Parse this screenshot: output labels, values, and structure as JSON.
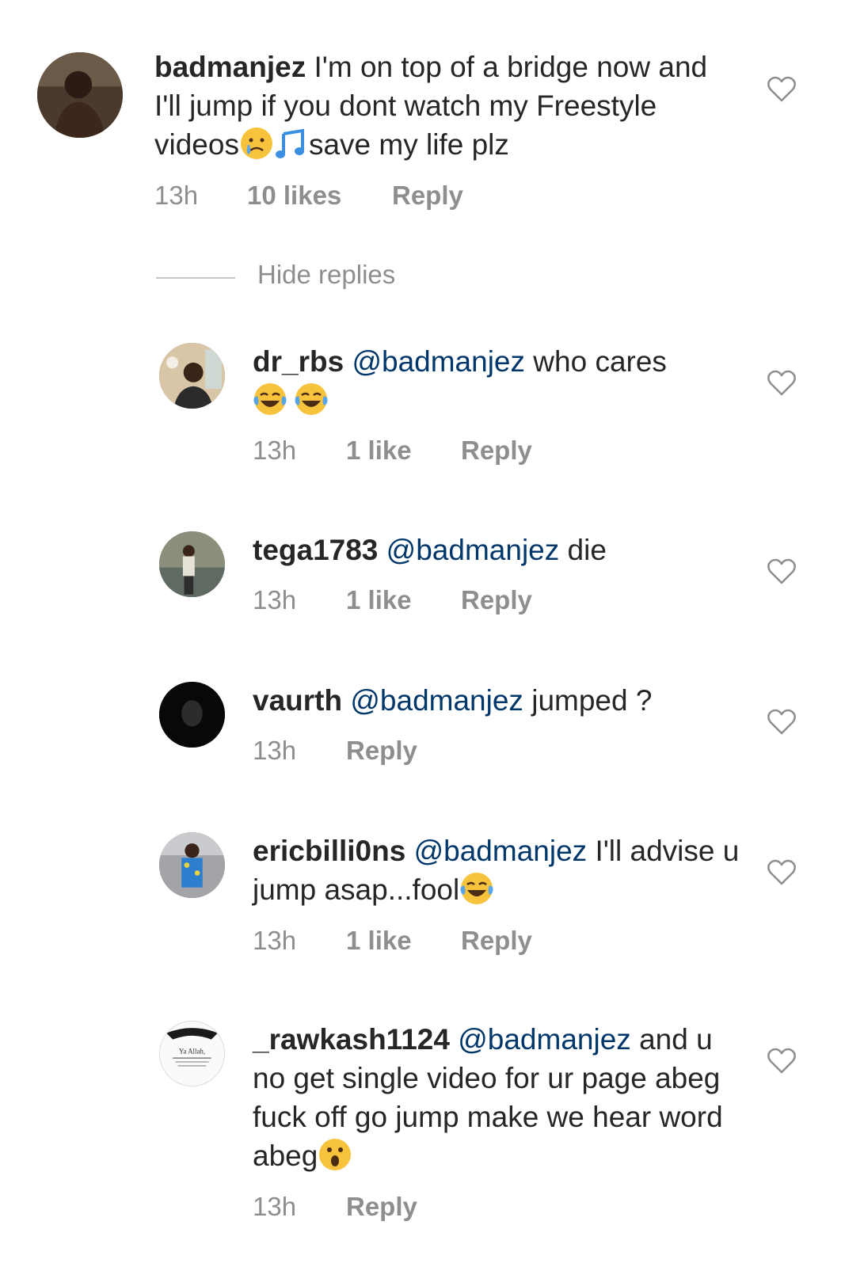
{
  "main_comment": {
    "username": "badmanjez",
    "text_part1": " I'm on top of a bridge now and I'll jump if you dont watch my Freestyle videos",
    "text_part2": "save my life plz",
    "time": "13h",
    "likes": "10 likes",
    "reply": "Reply"
  },
  "hide_replies": "Hide replies",
  "replies": [
    {
      "username": "dr_rbs",
      "mention": "@badmanjez",
      "text": " who cares",
      "time": "13h",
      "likes": "1 like",
      "reply": "Reply"
    },
    {
      "username": "tega1783",
      "mention": "@badmanjez",
      "text": " die",
      "time": "13h",
      "likes": "1 like",
      "reply": "Reply"
    },
    {
      "username": "vaurth",
      "mention": "@badmanjez",
      "text": " jumped ?",
      "time": "13h",
      "reply": "Reply"
    },
    {
      "username": "ericbilli0ns",
      "mention": "@badmanjez",
      "text": " I'll advise u jump asap...fool",
      "time": "13h",
      "likes": "1 like",
      "reply": "Reply"
    },
    {
      "username": "_rawkash1124",
      "mention": "@badmanjez",
      "text": " and u no get single video for ur page abeg fuck off go jump make we hear word abeg",
      "time": "13h",
      "reply": "Reply"
    }
  ],
  "avatar_6_text": "Ya Allah,",
  "icons": {
    "like": "heart-outline-icon",
    "crying": "crying-face-emoji",
    "note": "musical-note-emoji",
    "laughing": "tears-of-joy-emoji",
    "astonished": "astonished-face-emoji"
  }
}
